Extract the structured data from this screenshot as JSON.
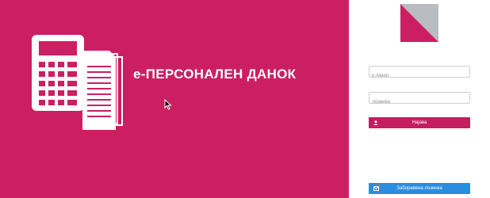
{
  "hero": {
    "title": "е-ПЕРСОНАЛЕН ДАНОК",
    "background_color": "#cc1f63",
    "illustration_icon": "calculator-documents-icon"
  },
  "sidebar": {
    "logo_icon": "diagonal-square-logo-icon",
    "email_placeholder": "Е-Меил",
    "password_placeholder": "Лозинка",
    "login_label": "Најава",
    "login_icon": "user-icon",
    "forgot_label": "Заборавена лозинка",
    "forgot_icon": "envelope-icon",
    "accent_color": "#c41e5f",
    "forgot_color": "#2a8ee0"
  }
}
